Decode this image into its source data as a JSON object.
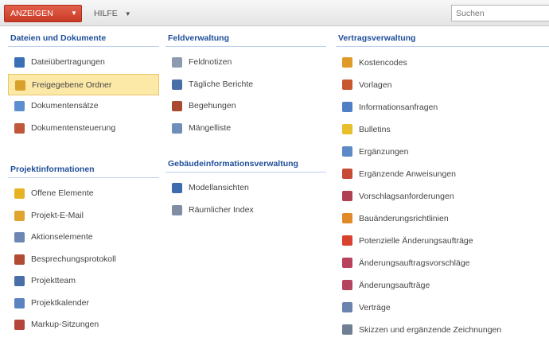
{
  "toolbar": {
    "anzeigen_label": "ANZEIGEN",
    "hilfe_label": "HILFE",
    "caret": "▼",
    "search_placeholder": "Suchen"
  },
  "sections": {
    "dateien": {
      "title": "Dateien und Dokumente",
      "items": [
        {
          "label": "Dateiübertragungen",
          "icon": "file-transfer-icon",
          "color": "#3a6fb5"
        },
        {
          "label": "Freigegebene Ordner",
          "icon": "shared-folder-icon",
          "color": "#d9a12b",
          "selected": true
        },
        {
          "label": "Dokumentensätze",
          "icon": "document-sets-icon",
          "color": "#5c8fd0"
        },
        {
          "label": "Dokumentensteuerung",
          "icon": "document-control-icon",
          "color": "#c0563a"
        }
      ]
    },
    "projekt": {
      "title": "Projektinformationen",
      "items": [
        {
          "label": "Offene Elemente",
          "icon": "open-items-icon",
          "color": "#e6b422"
        },
        {
          "label": "Projekt-E-Mail",
          "icon": "project-email-icon",
          "color": "#e0a431"
        },
        {
          "label": "Aktionselemente",
          "icon": "action-items-icon",
          "color": "#6d86b3"
        },
        {
          "label": "Besprechungsprotokoll",
          "icon": "meeting-minutes-icon",
          "color": "#b24a34"
        },
        {
          "label": "Projektteam",
          "icon": "project-team-icon",
          "color": "#4a6ea8"
        },
        {
          "label": "Projektkalender",
          "icon": "project-calendar-icon",
          "color": "#5b83c2"
        },
        {
          "label": "Markup-Sitzungen",
          "icon": "markup-sessions-icon",
          "color": "#b5443a"
        }
      ]
    },
    "feld": {
      "title": "Feldverwaltung",
      "items": [
        {
          "label": "Feldnotizen",
          "icon": "field-notes-icon",
          "color": "#8c9bb0"
        },
        {
          "label": "Tägliche Berichte",
          "icon": "daily-reports-icon",
          "color": "#4a6ea8"
        },
        {
          "label": "Begehungen",
          "icon": "walkthroughs-icon",
          "color": "#a84a2f"
        },
        {
          "label": "Mängelliste",
          "icon": "punch-list-icon",
          "color": "#6f8fb8"
        }
      ]
    },
    "gebaeude": {
      "title": "Gebäudeinformationsverwaltung",
      "items": [
        {
          "label": "Modellansichten",
          "icon": "model-views-icon",
          "color": "#3d6cae"
        },
        {
          "label": "Räumlicher Index",
          "icon": "spatial-index-icon",
          "color": "#7f8ea3"
        }
      ]
    },
    "vertrag": {
      "title": "Vertragsverwaltung",
      "items": [
        {
          "label": "Kostencodes",
          "icon": "cost-codes-icon",
          "color": "#e09a2a"
        },
        {
          "label": "Vorlagen",
          "icon": "submittals-icon",
          "color": "#c7572f"
        },
        {
          "label": "Informationsanfragen",
          "icon": "rfi-icon",
          "color": "#4f7fc4"
        },
        {
          "label": "Bulletins",
          "icon": "bulletins-icon",
          "color": "#e7bf2c"
        },
        {
          "label": "Ergänzungen",
          "icon": "supplements-icon",
          "color": "#5c8ac9"
        },
        {
          "label": "Ergänzende Anweisungen",
          "icon": "supplemental-instructions-icon",
          "color": "#c74a34"
        },
        {
          "label": "Vorschlagsanforderungen",
          "icon": "proposal-requests-icon",
          "color": "#b13f52"
        },
        {
          "label": "Bauänderungsrichtlinien",
          "icon": "change-directives-icon",
          "color": "#e08a2a"
        },
        {
          "label": "Potenzielle Änderungsaufträge",
          "icon": "potential-change-orders-icon",
          "color": "#d8422f"
        },
        {
          "label": "Änderungsauftragsvorschläge",
          "icon": "change-order-proposals-icon",
          "color": "#b8425c"
        },
        {
          "label": "Änderungsaufträge",
          "icon": "change-orders-icon",
          "color": "#b44560"
        },
        {
          "label": "Verträge",
          "icon": "contracts-icon",
          "color": "#6a84ad"
        },
        {
          "label": "Skizzen und ergänzende Zeichnungen",
          "icon": "sketches-icon",
          "color": "#707f95"
        }
      ]
    }
  }
}
